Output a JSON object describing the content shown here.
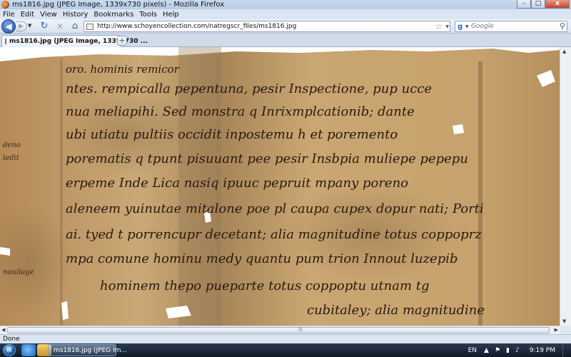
{
  "window": {
    "title": "ms1816.jpg (JPEG Image, 1339x730 pixels) - Mozilla Firefox",
    "controls": {
      "minimize": "–",
      "maximize": "□",
      "close": "x"
    }
  },
  "menu": [
    {
      "label": "File"
    },
    {
      "label": "Edit"
    },
    {
      "label": "View"
    },
    {
      "label": "History"
    },
    {
      "label": "Bookmarks"
    },
    {
      "label": "Tools"
    },
    {
      "label": "Help"
    }
  ],
  "nav": {
    "url": "http://www.schoyencollection.com/natregscr_files/ms1816.jpg",
    "search_placeholder": "Google"
  },
  "tabs": [
    {
      "label": "ms1816.jpg (JPEG Image, 1339x730 ..."
    }
  ],
  "status": {
    "text": "Done"
  },
  "taskbar": {
    "firefox_label": "ms1816.jpg (JPEG Im...",
    "lang": "EN",
    "time": "9:19 PM"
  },
  "colors": {
    "parchment": "#c9a46f",
    "ink": "#2a1a10",
    "chrome": "#dfe7f1",
    "taskbar": "#1a2738"
  },
  "manuscript": {
    "lines": [
      "oro. hominis remicor",
      "ntes. rempicalla pepentuna, pesir Inspectione, pup ucce",
      "nua meliapihi. Sed monstra q Inrixmplcationib; dante",
      "ubi utiatu pultiis occidit inpostemu h et poremento",
      "porematis q tpunt pisuuant pee pesir Insbpia muliepe pepepu",
      "erpeme Inde Lica nasiq ipuuc pepruit mpany poreno",
      "aleneem yuinutae mitalone poe pl caupa cupex dopur nati; Porti",
      "ai. tyed t porrencupr decetant; alia magnitudine totus coppoprz",
      "mpa comune hominu medy quantu pum trion Innout luzepib",
      "hominem thepo pueparte totus coppoptu utnam tg",
      "cubitaley; alia magnitudine"
    ],
    "margin_notes": [
      "deno",
      "ledit",
      "nouilage"
    ]
  }
}
